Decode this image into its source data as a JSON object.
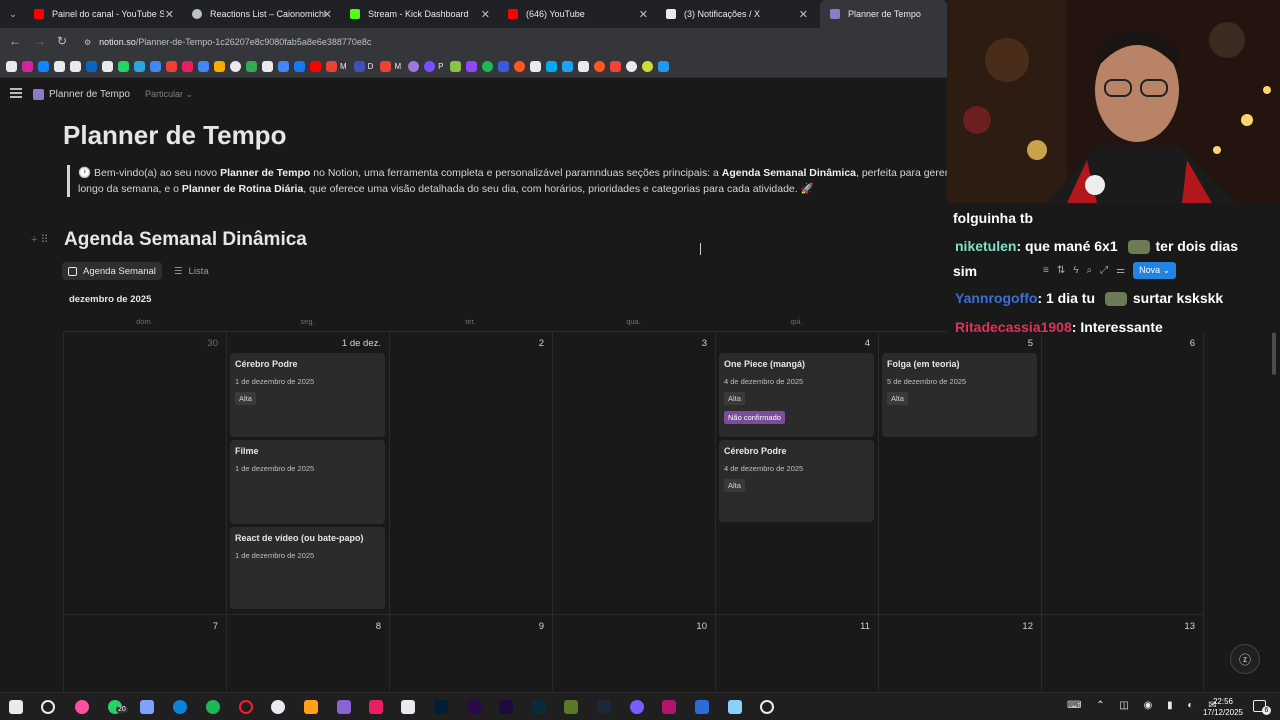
{
  "browser": {
    "tabs": [
      {
        "title": "Painel do canal - YouTube Studio",
        "color": "#ff0000"
      },
      {
        "title": "Reactions List – Caionomichi",
        "color": "#bdc1c6"
      },
      {
        "title": "Stream - Kick Dashboard",
        "color": "#53fc18"
      },
      {
        "title": "(646) YouTube",
        "color": "#ff0000"
      },
      {
        "title": "(3) Notificações / X",
        "color": "#e8eaed"
      },
      {
        "title": "Planner de Tempo",
        "color": "#8f7ac7"
      }
    ],
    "url_host": "notion.so",
    "url_path": "/Planner-de-Tempo-1c26207e8c9080fab5a8e6e388770e8c",
    "bookmark_labels": {
      "p": "P",
      "m1": "M",
      "d": "D",
      "m2": "M"
    }
  },
  "notion": {
    "breadcrumb_title": "Planner de Tempo",
    "breadcrumb_privacy": "Particular",
    "page_title": "Planner de Tempo",
    "callout": {
      "l1_a": "🕐 Bem-vindo(a) ao seu novo ",
      "l1_b": "Planner de Tempo",
      "l1_c": " no Notion, uma ferramenta completa e personalizável paramnduas seções principais: a ",
      "l1_d": "Agenda Semanal Dinâmica",
      "l1_e": ", perfeita para gerenciar",
      "l2_a": "longo da semana, e o ",
      "l2_b": "Planner de Rotina Diária",
      "l2_c": ", que oferece uma visão detalhada do seu dia, com horários, prioridades e categorias para cada atividade. 🚀"
    },
    "section_title": "Agenda Semanal Dinâmica",
    "views": [
      "Agenda Semanal",
      "Lista"
    ],
    "month_label": "dezembro de 2025",
    "weekdays": [
      "dom.",
      "seg.",
      "ter.",
      "qua.",
      "qui."
    ],
    "week1_days": [
      "30",
      "1 de dez.",
      "2",
      "3",
      "4",
      "5",
      "6"
    ],
    "week2_days": [
      "7",
      "8",
      "9",
      "10",
      "11",
      "12",
      "13"
    ],
    "cards": {
      "c1": {
        "title": "Cérebro Podre",
        "date": "1 de dezembro de 2025",
        "tag": "Alta"
      },
      "c2": {
        "title": "Filme",
        "date": "1 de dezembro de 2025"
      },
      "c3": {
        "title": "React de vídeo (ou bate-papo)",
        "date": "1 de dezembro de 2025"
      },
      "c4": {
        "title": "One Piece (mangá)",
        "date": "4 de dezembro de 2025",
        "tag": "Alta",
        "tag2": "Não confirmado"
      },
      "c5": {
        "title": "Cérebro Podre",
        "date": "4 de dezembro de 2025",
        "tag": "Alta"
      },
      "c6": {
        "title": "Folga (em teoria)",
        "date": "5 de dezembro de 2025",
        "tag": "Alta"
      }
    }
  },
  "chat": {
    "l1_text": "folguinha tb",
    "l2_name": "niketulen",
    "l2_text": ": que mané 6x1",
    "l2_text2": "ter dois dias",
    "l3_text": "sim",
    "l4_name": "Yannrogoffo",
    "l4_text": ": 1 dia tu",
    "l4_text2": "surtar kskskk",
    "l5_name": "Ritadecassia1908",
    "l5_text": ": Interessante",
    "colors": {
      "niketulen": "#7fe0c5",
      "yann": "#3b6fd8",
      "rita": "#e0325a"
    },
    "new_button": "Nova"
  },
  "taskbar": {
    "time": "22:56",
    "date": "17/12/2025",
    "badge": "20",
    "notif": "6"
  }
}
